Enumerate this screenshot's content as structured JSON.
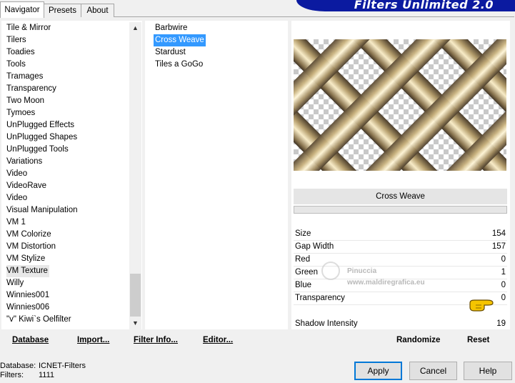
{
  "tabs": [
    "Navigator",
    "Presets",
    "About"
  ],
  "banner_title": "Filters Unlimited 2.0",
  "categories": [
    "Tile & Mirror",
    "Tilers",
    "Toadies",
    "Tools",
    "Tramages",
    "Transparency",
    "Two Moon",
    "Tymoes",
    "UnPlugged Effects",
    "UnPlugged Shapes",
    "UnPlugged Tools",
    "Variations",
    "Video",
    "VideoRave",
    "Video",
    "Visual Manipulation",
    "VM 1",
    "VM Colorize",
    "VM Distortion",
    "VM Stylize",
    "VM Texture",
    "Willy",
    "Winnies001",
    "Winnies006",
    "\"v\" Kiwi`s Oelfilter"
  ],
  "selected_category": "VM Texture",
  "filters": [
    "Barbwire",
    "Cross Weave",
    "Stardust",
    "Tiles a GoGo"
  ],
  "selected_filter": "Cross Weave",
  "preview": {
    "filter_name": "Cross Weave"
  },
  "params": [
    {
      "label": "Size",
      "value": "154"
    },
    {
      "label": "Gap Width",
      "value": "157"
    },
    {
      "label": "Red",
      "value": "0"
    },
    {
      "label": "Green",
      "value": "1"
    },
    {
      "label": "Blue",
      "value": "0"
    },
    {
      "label": "Transparency",
      "value": "0"
    }
  ],
  "shadow": {
    "label": "Shadow Intensity",
    "value": "19"
  },
  "watermark": {
    "line1": "Pinuccia",
    "line2": "www.maldiregrafica.eu"
  },
  "bottom_buttons": {
    "database": "Database",
    "import": "Import...",
    "filter_info": "Filter Info...",
    "editor": "Editor...",
    "randomize": "Randomize",
    "reset": "Reset"
  },
  "status": {
    "database_label": "Database:",
    "database_value": "ICNET-Filters",
    "filters_label": "Filters:",
    "filters_value": "1111"
  },
  "dialog_buttons": {
    "apply": "Apply",
    "cancel": "Cancel",
    "help": "Help"
  },
  "colors": {
    "selection": "#3399ff",
    "banner": "#0b1aa0"
  }
}
